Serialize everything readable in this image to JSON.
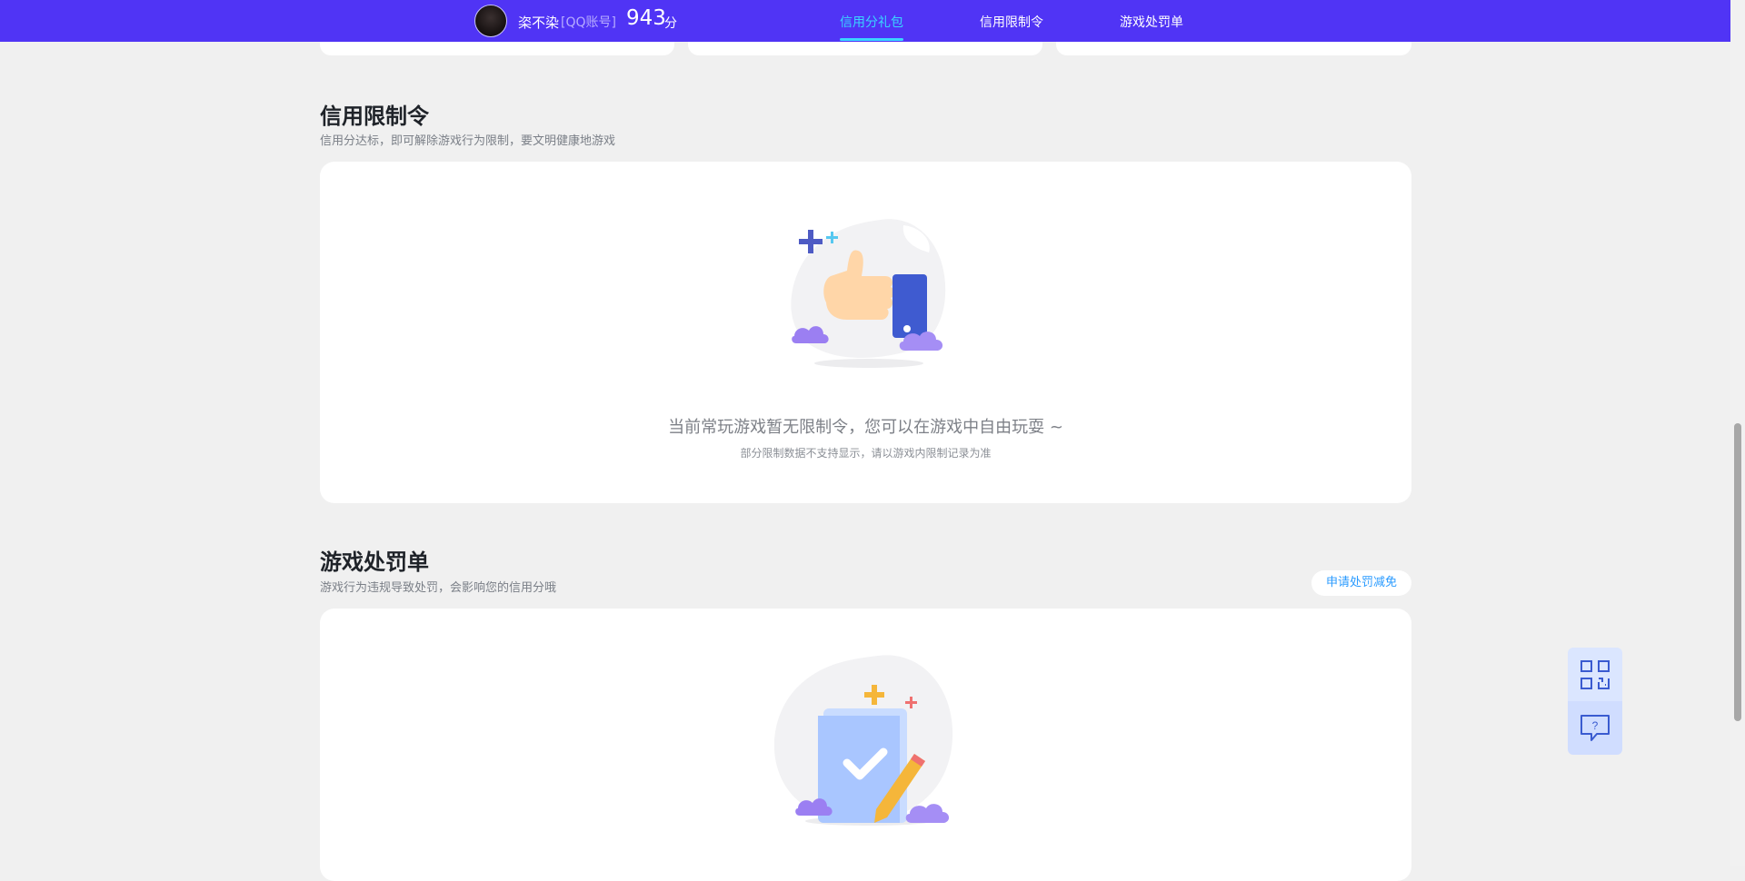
{
  "header": {
    "username": "栥不染",
    "account_type": "[QQ账号]",
    "score": "943",
    "score_unit": "分",
    "nav": [
      {
        "label": "信用分礼包",
        "active": true
      },
      {
        "label": "信用限制令",
        "active": false
      },
      {
        "label": "游戏处罚单",
        "active": false
      }
    ]
  },
  "restriction": {
    "title": "信用限制令",
    "subtitle": "信用分达标，即可解除游戏行为限制，要文明健康地游戏",
    "empty_main": "当前常玩游戏暂无限制令，您可以在游戏中自由玩耍 ~",
    "empty_sub": "部分限制数据不支持显示，请以游戏内限制记录为准"
  },
  "penalty": {
    "title": "游戏处罚单",
    "subtitle": "游戏行为违规导致处罚，会影响您的信用分哦",
    "appeal_label": "申请处罚减免"
  },
  "colors": {
    "nav_bg": "#5034f5",
    "nav_active": "#39d6ff",
    "page_bg": "#f0f0f0",
    "link_blue": "#2a9bff"
  },
  "icons": [
    "qr-code-icon",
    "feedback-question-icon",
    "thumbs-up-illustration",
    "document-pencil-illustration"
  ]
}
